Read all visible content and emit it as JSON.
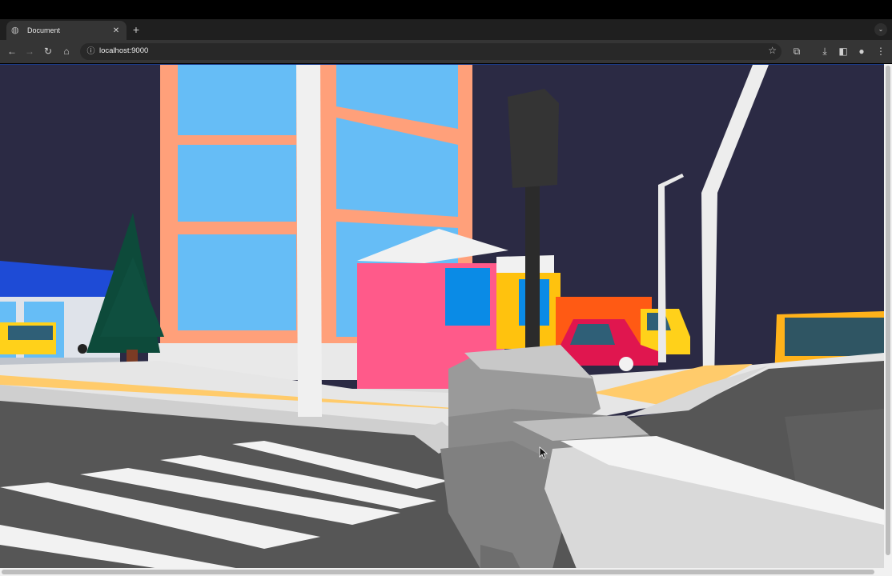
{
  "browser": {
    "tab_title": "Document",
    "tab_close_icon": "close-icon",
    "new_tab_icon": "plus-icon",
    "url": "localhost:9000",
    "toolbar_icons": [
      "back-icon",
      "forward-icon",
      "reload-icon",
      "home-icon",
      "info-icon",
      "star-icon",
      "extensions-icon",
      "download-icon",
      "side-panel-icon",
      "profile-icon",
      "more-icon"
    ]
  },
  "scene": {
    "description_colors": {
      "sky": "#2b2a44",
      "road": "#565656",
      "sidewalk": "#e6e6e6",
      "curb_stripe": "#ffcb6b",
      "building_frame": "#ffa07a",
      "building_glass": "#66bdf6",
      "kiosk_pink": "#ff5a8a",
      "kiosk_yellow": "#ffc20e",
      "truck_orange": "#ff5a14",
      "gun_gray": "#8d8d8d"
    }
  }
}
